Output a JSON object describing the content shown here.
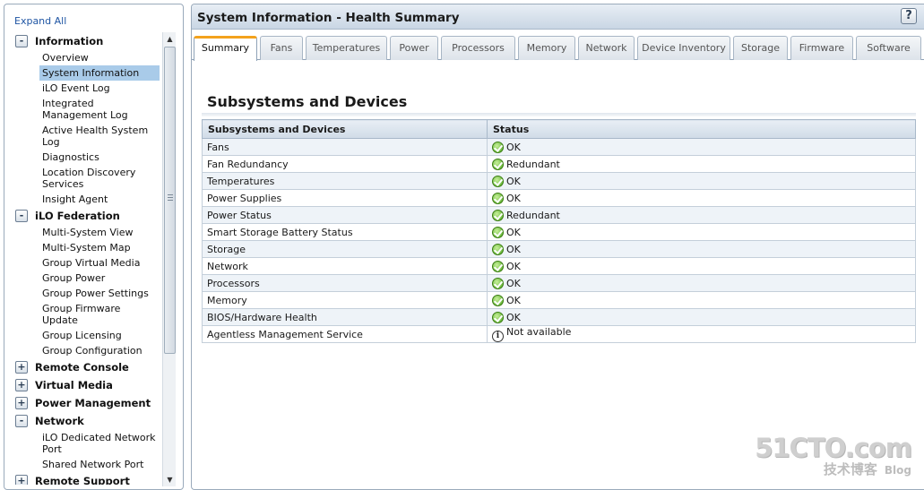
{
  "nav": {
    "expand_all": "Expand All",
    "groups": [
      {
        "label": "Information",
        "toggle": "-",
        "items": [
          "Overview",
          "System Information",
          "iLO Event Log",
          "Integrated Management Log",
          "Active Health System Log",
          "Diagnostics",
          "Location Discovery Services",
          "Insight Agent"
        ]
      },
      {
        "label": "iLO Federation",
        "toggle": "-",
        "items": [
          "Multi-System View",
          "Multi-System Map",
          "Group Virtual Media",
          "Group Power",
          "Group Power Settings",
          "Group Firmware Update",
          "Group Licensing",
          "Group Configuration"
        ]
      },
      {
        "label": "Remote Console",
        "toggle": "+",
        "items": []
      },
      {
        "label": "Virtual Media",
        "toggle": "+",
        "items": []
      },
      {
        "label": "Power Management",
        "toggle": "+",
        "items": []
      },
      {
        "label": "Network",
        "toggle": "-",
        "items": [
          "iLO Dedicated Network Port",
          "Shared Network Port"
        ]
      },
      {
        "label": "Remote Support",
        "toggle": "+",
        "items": []
      }
    ],
    "selected_item": "System Information",
    "scroll_up": "▲",
    "scroll_down": "▼"
  },
  "header": {
    "title": "System Information - Health Summary",
    "help_label": "?"
  },
  "tabs": [
    {
      "label": "Summary",
      "active": true
    },
    {
      "label": "Fans"
    },
    {
      "label": "Temperatures"
    },
    {
      "label": "Power"
    },
    {
      "label": "Processors"
    },
    {
      "label": "Memory"
    },
    {
      "label": "Network"
    },
    {
      "label": "Device Inventory"
    },
    {
      "label": "Storage"
    },
    {
      "label": "Firmware"
    },
    {
      "label": "Software"
    }
  ],
  "section": {
    "title": "Subsystems and Devices",
    "columns": [
      "Subsystems and Devices",
      "Status"
    ],
    "rows": [
      {
        "name": "Fans",
        "status": "OK",
        "icon": "ok-check-icon"
      },
      {
        "name": "Fan Redundancy",
        "status": "Redundant",
        "icon": "ok-check-icon"
      },
      {
        "name": "Temperatures",
        "status": "OK",
        "icon": "ok-check-icon"
      },
      {
        "name": "Power Supplies",
        "status": "OK",
        "icon": "ok-check-icon"
      },
      {
        "name": "Power Status",
        "status": "Redundant",
        "icon": "ok-check-icon"
      },
      {
        "name": "Smart Storage Battery Status",
        "status": "OK",
        "icon": "ok-check-icon"
      },
      {
        "name": "Storage",
        "status": "OK",
        "icon": "ok-check-icon"
      },
      {
        "name": "Network",
        "status": "OK",
        "icon": "ok-check-icon"
      },
      {
        "name": "Processors",
        "status": "OK",
        "icon": "ok-check-icon"
      },
      {
        "name": "Memory",
        "status": "OK",
        "icon": "ok-check-icon"
      },
      {
        "name": "BIOS/Hardware Health",
        "status": "OK",
        "icon": "ok-check-icon"
      },
      {
        "name": "Agentless Management Service",
        "status": "Not available",
        "icon": "info-icon"
      }
    ]
  },
  "watermark": {
    "logo": "51CTO.com",
    "subtitle": "技术博客",
    "blog": "Blog"
  },
  "colors": {
    "active_tab_accent": "#f3a21c",
    "selected_nav_bg": "#a9cbe9",
    "ok_icon": "#4aa51b",
    "link": "#1f55a3"
  }
}
